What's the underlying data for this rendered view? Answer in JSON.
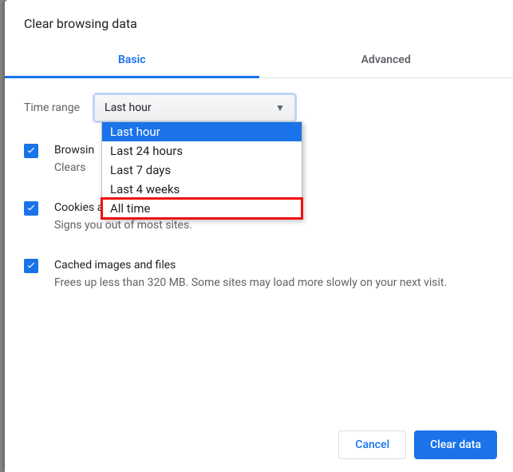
{
  "title": "Clear browsing data",
  "tabs": {
    "basic": "Basic",
    "advanced": "Advanced"
  },
  "timerange": {
    "label": "Time range",
    "selected": "Last hour",
    "options": [
      "Last hour",
      "Last 24 hours",
      "Last 7 days",
      "Last 4 weeks",
      "All time"
    ],
    "highlight_index": 4
  },
  "items": [
    {
      "label": "Browsing history",
      "label_truncated": "Browsin",
      "sub": "Clears history and autocompletions in the address bar.",
      "sub_truncated": "Clears "
    },
    {
      "label": "Cookies and other site data",
      "sub": "Signs you out of most sites."
    },
    {
      "label": "Cached images and files",
      "sub": "Frees up less than 320 MB. Some sites may load more slowly on your next visit."
    }
  ],
  "buttons": {
    "cancel": "Cancel",
    "confirm": "Clear data"
  }
}
